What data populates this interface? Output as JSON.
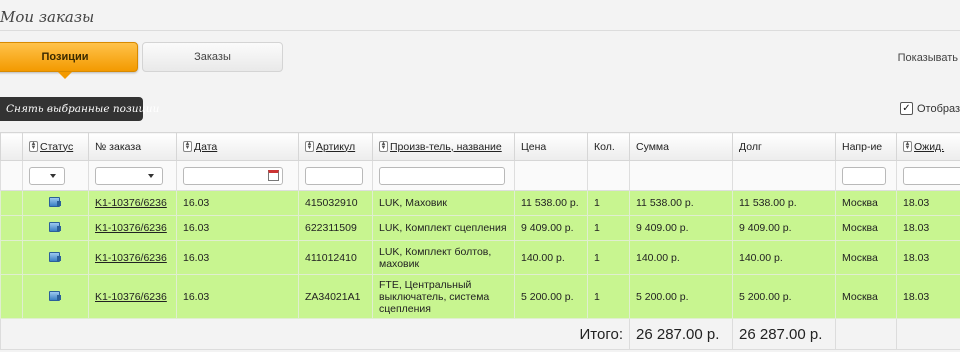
{
  "page": {
    "title": "Мои заказы"
  },
  "tabs": [
    {
      "label": "Позиции",
      "active": true
    },
    {
      "label": "Заказы",
      "active": false
    }
  ],
  "show_label": "Показывать",
  "remove_button": "Снять выбранные позиции",
  "display_option": {
    "label": "Отобрази",
    "checked": true
  },
  "columns": {
    "status": "Статус",
    "order_no": "№ заказа",
    "date": "Дата",
    "article": "Артикул",
    "maker": "Произв-тель, название",
    "price": "Цена",
    "qty": "Кол.",
    "sum": "Сумма",
    "debt": "Долг",
    "direction": "Напр-ие",
    "expected": "Ожид."
  },
  "rows": [
    {
      "order": "K1-10376/6236",
      "date": "16.03",
      "article": "415032910",
      "maker": "LUK, Маховик",
      "price": "11 538.00 р.",
      "qty": "1",
      "sum": "11 538.00 р.",
      "debt": "11 538.00 р.",
      "direction": "Москва",
      "expected": "18.03"
    },
    {
      "order": "K1-10376/6236",
      "date": "16.03",
      "article": "622311509",
      "maker": "LUK, Комплект сцепления",
      "price": "9 409.00 р.",
      "qty": "1",
      "sum": "9 409.00 р.",
      "debt": "9 409.00 р.",
      "direction": "Москва",
      "expected": "18.03"
    },
    {
      "order": "K1-10376/6236",
      "date": "16.03",
      "article": "411012410",
      "maker": "LUK, Комплект болтов, маховик",
      "price": "140.00 р.",
      "qty": "1",
      "sum": "140.00 р.",
      "debt": "140.00 р.",
      "direction": "Москва",
      "expected": "18.03"
    },
    {
      "order": "K1-10376/6236",
      "date": "16.03",
      "article": "ZA34021A1",
      "maker": "FTE, Центральный выключатель, система сцепления",
      "price": "5 200.00 р.",
      "qty": "1",
      "sum": "5 200.00 р.",
      "debt": "5 200.00 р.",
      "direction": "Москва",
      "expected": "18.03"
    }
  ],
  "totals": {
    "label": "Итого:",
    "sum": "26 287.00 р.",
    "debt": "26 287.00 р."
  },
  "colors": {
    "accent": "#f39a00",
    "row_highlight": "#c8f590"
  }
}
